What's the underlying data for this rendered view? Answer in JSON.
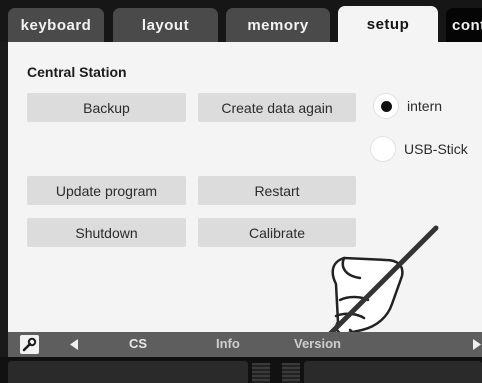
{
  "tabs": [
    {
      "label": "keyboard",
      "active": false
    },
    {
      "label": "layout",
      "active": false
    },
    {
      "label": "memory",
      "active": false
    },
    {
      "label": "setup",
      "active": true
    },
    {
      "label": "cont",
      "active": false
    }
  ],
  "panel": {
    "title": "Central Station",
    "buttons": {
      "backup": "Backup",
      "create_data_again": "Create data again",
      "update_program": "Update program",
      "restart": "Restart",
      "shutdown": "Shutdown",
      "calibrate": "Calibrate"
    },
    "storage_options": [
      {
        "label": "intern",
        "selected": true
      },
      {
        "label": "USB-Stick",
        "selected": false
      }
    ]
  },
  "bottom_bar": {
    "tool_icon": "wrench-icon",
    "items": [
      "CS",
      "Info",
      "Version"
    ]
  },
  "colors": {
    "active_tab": "#f4f4f4",
    "inactive_tab": "#4a4a4a",
    "button": "#dcdcdc",
    "bottom_bar": "#5e5e5e"
  }
}
